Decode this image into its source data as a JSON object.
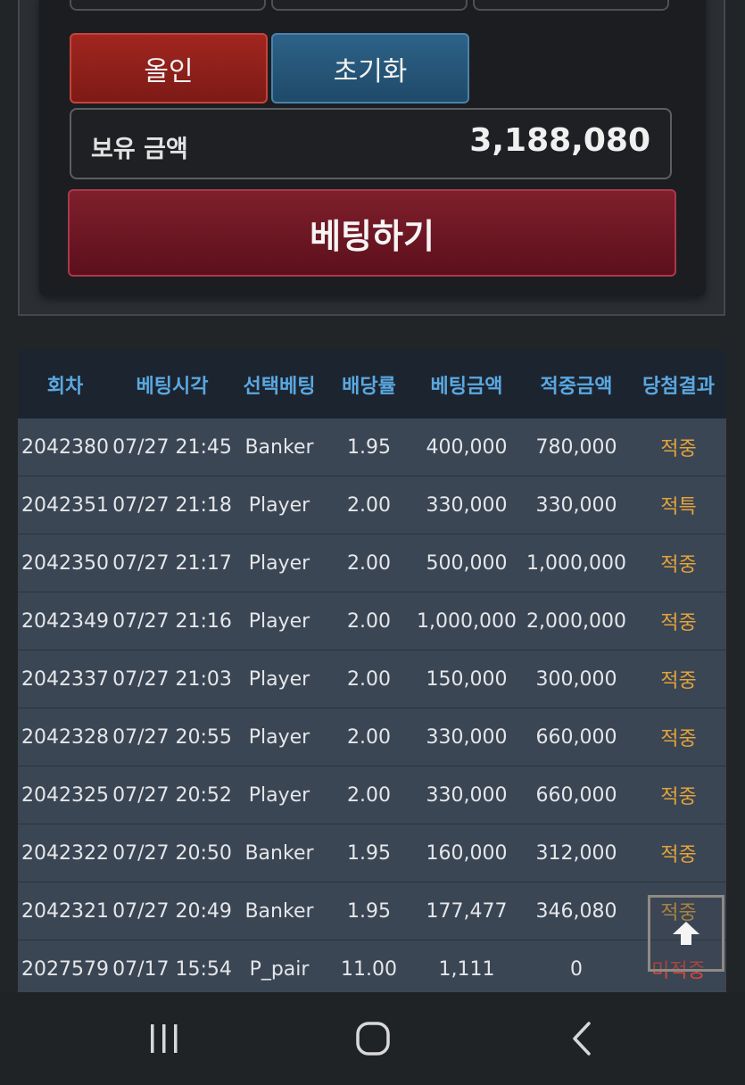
{
  "controls": {
    "allin_label": "올인",
    "reset_label": "초기화",
    "balance_label": "보유 금액",
    "balance_value": "3,188,080",
    "bet_label": "베팅하기"
  },
  "history": {
    "columns": [
      "회차",
      "베팅시각",
      "선택베팅",
      "배당률",
      "베팅금액",
      "적중금액",
      "당첨결과"
    ],
    "rows": [
      {
        "round": "2042380",
        "time": "07/27 21:45",
        "pick": "Banker",
        "odds": "1.95",
        "stake": "400,000",
        "payout": "780,000",
        "result": "적중"
      },
      {
        "round": "2042351",
        "time": "07/27 21:18",
        "pick": "Player",
        "odds": "2.00",
        "stake": "330,000",
        "payout": "330,000",
        "result": "적특"
      },
      {
        "round": "2042350",
        "time": "07/27 21:17",
        "pick": "Player",
        "odds": "2.00",
        "stake": "500,000",
        "payout": "1,000,000",
        "result": "적중"
      },
      {
        "round": "2042349",
        "time": "07/27 21:16",
        "pick": "Player",
        "odds": "2.00",
        "stake": "1,000,000",
        "payout": "2,000,000",
        "result": "적중"
      },
      {
        "round": "2042337",
        "time": "07/27 21:03",
        "pick": "Player",
        "odds": "2.00",
        "stake": "150,000",
        "payout": "300,000",
        "result": "적중"
      },
      {
        "round": "2042328",
        "time": "07/27 20:55",
        "pick": "Player",
        "odds": "2.00",
        "stake": "330,000",
        "payout": "660,000",
        "result": "적중"
      },
      {
        "round": "2042325",
        "time": "07/27 20:52",
        "pick": "Player",
        "odds": "2.00",
        "stake": "330,000",
        "payout": "660,000",
        "result": "적중"
      },
      {
        "round": "2042322",
        "time": "07/27 20:50",
        "pick": "Banker",
        "odds": "1.95",
        "stake": "160,000",
        "payout": "312,000",
        "result": "적중"
      },
      {
        "round": "2042321",
        "time": "07/27 20:49",
        "pick": "Banker",
        "odds": "1.95",
        "stake": "177,477",
        "payout": "346,080",
        "result": "적중"
      },
      {
        "round": "2027579",
        "time": "07/17 15:54",
        "pick": "P_pair",
        "odds": "11.00",
        "stake": "1,111",
        "payout": "0",
        "result": "미적중"
      }
    ]
  },
  "colors": {
    "header_text": "#5aa8e0",
    "hit": "#e3a33b",
    "miss": "#e0443a",
    "allin": "#a1261f",
    "reset": "#2d6288",
    "bet": "#7f1f2c"
  },
  "icons": {
    "scroll_top": "arrow-up-icon",
    "nav_recents": "recent-apps-icon",
    "nav_home": "home-icon",
    "nav_back": "back-icon"
  }
}
